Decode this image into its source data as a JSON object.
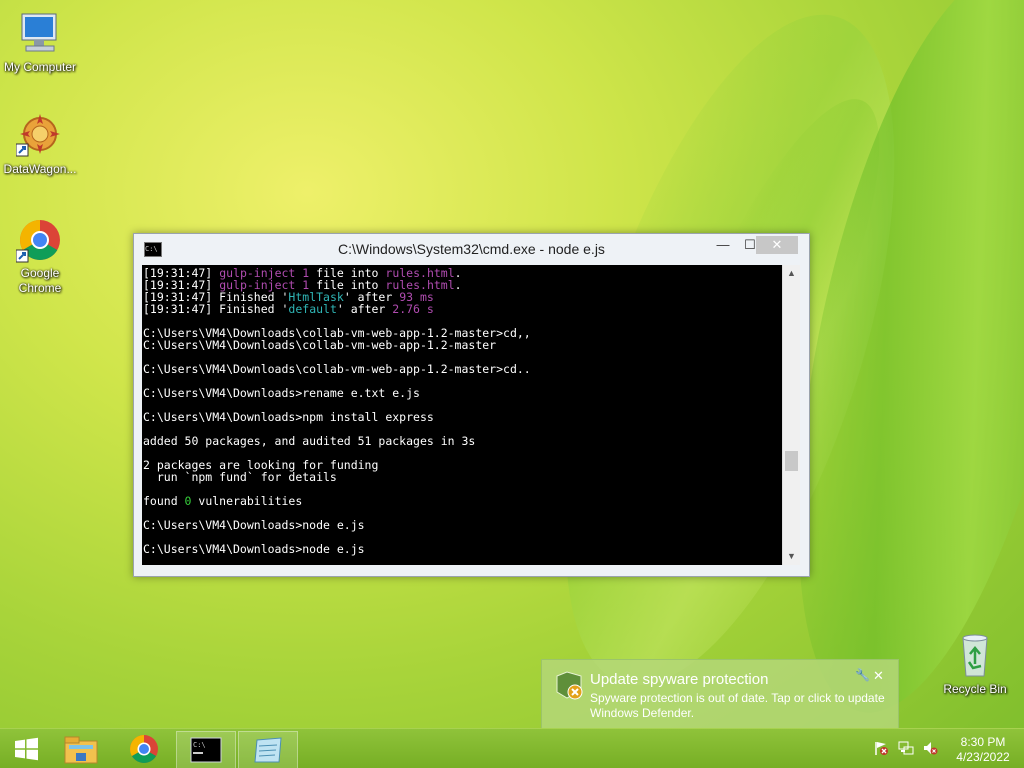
{
  "desktop": {
    "icons": [
      {
        "label": "My Computer",
        "icon": "computer-icon"
      },
      {
        "label": "DataWagon...",
        "icon": "datawagon-icon"
      },
      {
        "label": "Google Chrome",
        "icon": "chrome-icon"
      },
      {
        "label": "Recycle Bin",
        "icon": "recycle-bin-icon"
      }
    ]
  },
  "console_window": {
    "title": "C:\\Windows\\System32\\cmd.exe - node  e.js",
    "controls": {
      "minimize": "—",
      "maximize": "☐",
      "close": "✕"
    },
    "lines": [
      {
        "ts": "[19:31:47]",
        "parts": [
          {
            "t": " ",
            "c": ""
          },
          {
            "t": "gulp-inject",
            "c": "mag"
          },
          {
            "t": " ",
            "c": ""
          },
          {
            "t": "1",
            "c": "mag"
          },
          {
            "t": " file into ",
            "c": "wht"
          },
          {
            "t": "rules.html",
            "c": "mag"
          },
          {
            "t": ".",
            "c": "wht"
          }
        ]
      },
      {
        "ts": "[19:31:47]",
        "parts": [
          {
            "t": " ",
            "c": ""
          },
          {
            "t": "gulp-inject",
            "c": "mag"
          },
          {
            "t": " ",
            "c": ""
          },
          {
            "t": "1",
            "c": "mag"
          },
          {
            "t": " file into ",
            "c": "wht"
          },
          {
            "t": "rules.html",
            "c": "mag"
          },
          {
            "t": ".",
            "c": "wht"
          }
        ]
      },
      {
        "ts": "[19:31:47]",
        "parts": [
          {
            "t": " Finished '",
            "c": "wht"
          },
          {
            "t": "HtmlTask",
            "c": "cyn"
          },
          {
            "t": "' after ",
            "c": "wht"
          },
          {
            "t": "93 ms",
            "c": "mag"
          }
        ]
      },
      {
        "ts": "[19:31:47]",
        "parts": [
          {
            "t": " Finished '",
            "c": "wht"
          },
          {
            "t": "default",
            "c": "cyn"
          },
          {
            "t": "' after ",
            "c": "wht"
          },
          {
            "t": "2.76 s",
            "c": "mag"
          }
        ]
      },
      {
        "ts": "",
        "parts": [
          {
            "t": "",
            "c": ""
          }
        ]
      },
      {
        "ts": "",
        "parts": [
          {
            "t": "C:\\Users\\VM4\\Downloads\\collab-vm-web-app-1.2-master>cd,,",
            "c": "wht"
          }
        ]
      },
      {
        "ts": "",
        "parts": [
          {
            "t": "C:\\Users\\VM4\\Downloads\\collab-vm-web-app-1.2-master",
            "c": "wht"
          }
        ]
      },
      {
        "ts": "",
        "parts": [
          {
            "t": "",
            "c": ""
          }
        ]
      },
      {
        "ts": "",
        "parts": [
          {
            "t": "C:\\Users\\VM4\\Downloads\\collab-vm-web-app-1.2-master>cd..",
            "c": "wht"
          }
        ]
      },
      {
        "ts": "",
        "parts": [
          {
            "t": "",
            "c": ""
          }
        ]
      },
      {
        "ts": "",
        "parts": [
          {
            "t": "C:\\Users\\VM4\\Downloads>rename e.txt e.js",
            "c": "wht"
          }
        ]
      },
      {
        "ts": "",
        "parts": [
          {
            "t": "",
            "c": ""
          }
        ]
      },
      {
        "ts": "",
        "parts": [
          {
            "t": "C:\\Users\\VM4\\Downloads>npm install express",
            "c": "wht"
          }
        ]
      },
      {
        "ts": "",
        "parts": [
          {
            "t": "",
            "c": ""
          }
        ]
      },
      {
        "ts": "",
        "parts": [
          {
            "t": "added 50 packages, and audited 51 packages in 3s",
            "c": "wht"
          }
        ]
      },
      {
        "ts": "",
        "parts": [
          {
            "t": "",
            "c": ""
          }
        ]
      },
      {
        "ts": "",
        "parts": [
          {
            "t": "2 packages are looking for funding",
            "c": "wht"
          }
        ]
      },
      {
        "ts": "",
        "parts": [
          {
            "t": "  run `npm fund` for details",
            "c": "wht"
          }
        ]
      },
      {
        "ts": "",
        "parts": [
          {
            "t": "",
            "c": ""
          }
        ]
      },
      {
        "ts": "",
        "parts": [
          {
            "t": "found ",
            "c": "wht"
          },
          {
            "t": "0",
            "c": "grn"
          },
          {
            "t": " vulnerabilities",
            "c": "wht"
          }
        ]
      },
      {
        "ts": "",
        "parts": [
          {
            "t": "",
            "c": ""
          }
        ]
      },
      {
        "ts": "",
        "parts": [
          {
            "t": "C:\\Users\\VM4\\Downloads>node e.js",
            "c": "wht"
          }
        ]
      },
      {
        "ts": "",
        "parts": [
          {
            "t": "",
            "c": ""
          }
        ]
      },
      {
        "ts": "",
        "parts": [
          {
            "t": "C:\\Users\\VM4\\Downloads>node e.js",
            "c": "wht"
          }
        ]
      }
    ]
  },
  "notification": {
    "title": "Update spyware protection",
    "body": "Spyware protection is out of date. Tap or click to update Windows Defender.",
    "close": "✕",
    "pin": "🔧"
  },
  "taskbar": {
    "items": [
      "start-button",
      "file-explorer",
      "chrome",
      "command-prompt",
      "notepad"
    ],
    "clock": {
      "time": "8:30 PM",
      "date": "4/23/2022"
    }
  },
  "colors": {
    "magenta": "#b04cb0",
    "green": "#36d13b",
    "cyan": "#2fb5b5",
    "taskbar": "#7db52a"
  }
}
